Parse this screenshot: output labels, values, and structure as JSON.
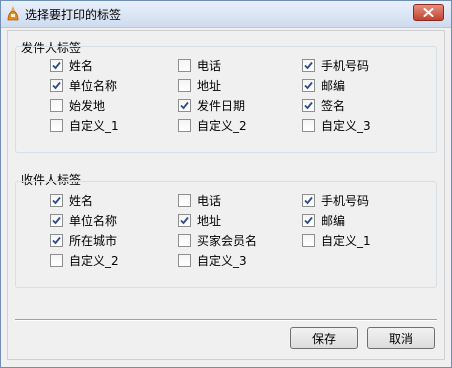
{
  "window": {
    "title": "选择要打印的标签"
  },
  "sender": {
    "label": "发件人标签",
    "options": [
      {
        "label": "姓名",
        "checked": true
      },
      {
        "label": "电话",
        "checked": false
      },
      {
        "label": "手机号码",
        "checked": true
      },
      {
        "label": "单位名称",
        "checked": true
      },
      {
        "label": "地址",
        "checked": false
      },
      {
        "label": "邮编",
        "checked": true
      },
      {
        "label": "始发地",
        "checked": false
      },
      {
        "label": "发件日期",
        "checked": true
      },
      {
        "label": "签名",
        "checked": true
      },
      {
        "label": "自定义_1",
        "checked": false
      },
      {
        "label": "自定义_2",
        "checked": false
      },
      {
        "label": "自定义_3",
        "checked": false
      }
    ]
  },
  "receiver": {
    "label": "收件人标签",
    "options": [
      {
        "label": "姓名",
        "checked": true
      },
      {
        "label": "电话",
        "checked": false
      },
      {
        "label": "手机号码",
        "checked": true
      },
      {
        "label": "单位名称",
        "checked": true
      },
      {
        "label": "地址",
        "checked": true
      },
      {
        "label": "邮编",
        "checked": true
      },
      {
        "label": "所在城市",
        "checked": true
      },
      {
        "label": "买家会员名",
        "checked": false
      },
      {
        "label": "自定义_1",
        "checked": false
      },
      {
        "label": "自定义_2",
        "checked": false
      },
      {
        "label": "自定义_3",
        "checked": false
      }
    ]
  },
  "buttons": {
    "save": "保存",
    "cancel": "取消"
  }
}
